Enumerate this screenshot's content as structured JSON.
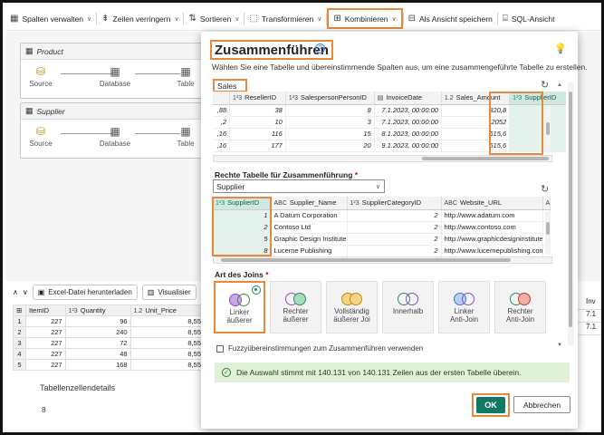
{
  "toolbar": {
    "items": [
      {
        "label": "Spalten verwalten",
        "icon": "columns-icon"
      },
      {
        "label": "Zeilen verringern",
        "icon": "filter-rows-icon"
      },
      {
        "label": "Sortieren",
        "icon": "sort-icon"
      },
      {
        "label": "Transformieren",
        "icon": "transform-icon"
      },
      {
        "label": "Kombinieren",
        "icon": "combine-icon"
      },
      {
        "label": "Als Ansicht speichern",
        "icon": "save-view-icon"
      },
      {
        "label": "SQL-Ansicht",
        "icon": "sql-icon"
      }
    ]
  },
  "queries": [
    {
      "name": "Product",
      "steps": [
        "Source",
        "Database",
        "Table"
      ]
    },
    {
      "name": "Supplier",
      "steps": [
        "Source",
        "Database",
        "Table"
      ]
    }
  ],
  "bottom": {
    "export_label": "Excel-Datei herunterladen",
    "visualize_label": "Visualisier",
    "columns": [
      "ItemID",
      "Quantity",
      "Unit_Price"
    ],
    "col_types": [
      "",
      "1²3",
      "1.2"
    ],
    "rows": [
      [
        "1",
        "227",
        "96",
        "8,55"
      ],
      [
        "2",
        "227",
        "240",
        "8,55"
      ],
      [
        "3",
        "227",
        "72",
        "8,55"
      ],
      [
        "4",
        "227",
        "48",
        "8,55"
      ],
      [
        "5",
        "227",
        "168",
        "8,55"
      ]
    ],
    "details_title": "Tabellenzellendetails",
    "details_count": "8",
    "right_strip": [
      "Inv",
      "7.1",
      "7.1"
    ]
  },
  "dialog": {
    "title": "Zusammenführen",
    "description": "Wählen Sie eine Tabelle und übereinstimmende Spalten aus, um eine zusammengeführte Tabelle zu erstellen.",
    "left_table": "Sales",
    "left_columns": [
      {
        "name": "",
        "type": ""
      },
      {
        "name": "ResellerID",
        "type": "1²3"
      },
      {
        "name": "SalespersonPersonID",
        "type": "1²3"
      },
      {
        "name": "InvoiceDate",
        "type": "date"
      },
      {
        "name": "Sales_Amount",
        "type": "1.2"
      },
      {
        "name": "SupplierID",
        "type": "1²3"
      }
    ],
    "left_rows": [
      [
        ",88",
        "38",
        "8",
        "7.1.2023, 00:00:00",
        "820,8",
        ""
      ],
      [
        ",2",
        "10",
        "3",
        "7.1.2023, 00:00:00",
        "2052",
        ""
      ],
      [
        ",16",
        "116",
        "15",
        "8.1.2023, 00:00:00",
        "615,6",
        ""
      ],
      [
        ",16",
        "177",
        "20",
        "9.1.2023, 00:00:00",
        "615,6",
        ""
      ]
    ],
    "right_label": "Rechte Tabelle für Zusammenführung",
    "required_mark": "*",
    "right_table": "Supplier",
    "right_columns": [
      {
        "name": "SupplierID",
        "type": "1²3"
      },
      {
        "name": "Supplier_Name",
        "type": "ABC"
      },
      {
        "name": "SupplierCategoryID",
        "type": "1²3"
      },
      {
        "name": "Website_URL",
        "type": "ABC"
      },
      {
        "name": "",
        "type": "AB"
      }
    ],
    "right_rows": [
      [
        "1",
        "A Datum Corporation",
        "2",
        "http://www.adatum.com",
        ""
      ],
      [
        "2",
        "Contoso Ltd",
        "2",
        "http://www.contoso.com",
        ""
      ],
      [
        "5",
        "Graphic Design Institute",
        "2",
        "http://www.graphicdesigninstitute.com",
        ""
      ],
      [
        "8",
        "Lucerne Publishing",
        "2",
        "http://www.lucernepublishing.com",
        ""
      ]
    ],
    "join_label": "Art des Joins",
    "join_types": [
      {
        "line1": "Linker",
        "line2": "äußerer",
        "selected": true
      },
      {
        "line1": "Rechter",
        "line2": "äußerer",
        "selected": false
      },
      {
        "line1": "Vollständig",
        "line2": "äußerer Joi",
        "selected": false
      },
      {
        "line1": "Innerhalb",
        "line2": "",
        "selected": false
      },
      {
        "line1": "Linker",
        "line2": "Anti-Join",
        "selected": false
      },
      {
        "line1": "Rechter",
        "line2": "Anti-Join",
        "selected": false
      }
    ],
    "fuzzy_label": "Fuzzyübereinstimmungen zum Zusammenführen verwenden",
    "status": "Die Auswahl stimmt mit 140.131 von 140.131 Zeilen aus der ersten Tabelle überein.",
    "ok_label": "OK",
    "cancel_label": "Abbrechen"
  },
  "colors": {
    "accent": "#117865",
    "highlight": "#e8883c",
    "status_bg": "#dff2d8",
    "selected_col": "#cfe9e2"
  }
}
